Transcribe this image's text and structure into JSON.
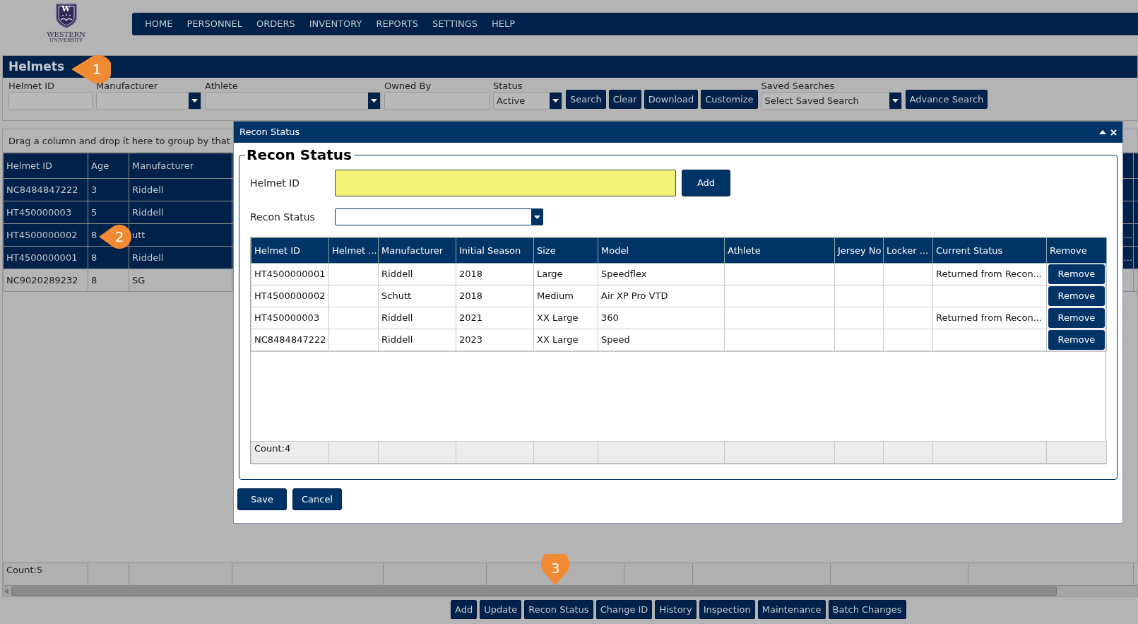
{
  "logo": {
    "monogram": "W",
    "name": "WESTERN",
    "subtitle": "UNIVERSITY"
  },
  "nav": [
    {
      "label": "HOME"
    },
    {
      "label": "PERSONNEL"
    },
    {
      "label": "ORDERS"
    },
    {
      "label": "INVENTORY"
    },
    {
      "label": "REPORTS"
    },
    {
      "label": "SETTINGS"
    },
    {
      "label": "HELP"
    }
  ],
  "panel": {
    "title": "Helmets"
  },
  "filters": [
    {
      "kind": "text",
      "label": "Helmet ID"
    },
    {
      "kind": "select",
      "label": "Manufacturer"
    },
    {
      "kind": "select",
      "label": "Athlete"
    },
    {
      "kind": "text",
      "label": "Owned By"
    },
    {
      "kind": "select",
      "label": "Status",
      "value": "Active"
    }
  ],
  "filter_buttons": [
    "Search",
    "Clear",
    "Download",
    "Customize"
  ],
  "saved_searches": {
    "label": "Saved Searches",
    "value": "Select Saved Search"
  },
  "advance_button": "Advance Search",
  "grid": {
    "group_hint": "Drag a column and drop it here to group by that",
    "columns": [
      "Helmet ID",
      "Age",
      "Manufacturer"
    ],
    "rows": [
      {
        "cells": [
          "NC8484847222",
          "3",
          "Riddell"
        ],
        "selected": true
      },
      {
        "cells": [
          "HT450000003",
          "5",
          "Riddell"
        ],
        "selected": true
      },
      {
        "cells": [
          "HT4500000002",
          "8",
          "utt"
        ],
        "selected": true,
        "tail": "..."
      },
      {
        "cells": [
          "HT4500000001",
          "8",
          "Riddell"
        ],
        "selected": true,
        "tail": "..."
      },
      {
        "cells": [
          "NC9020289232",
          "8",
          "SG"
        ],
        "selected": false
      }
    ],
    "count": "Count:5"
  },
  "actions": [
    "Add",
    "Update",
    "Recon Status",
    "Change ID",
    "History",
    "Inspection",
    "Maintenance",
    "Batch Changes"
  ],
  "dialog": {
    "title": "Recon Status",
    "legend": "Recon Status",
    "helmet_field": {
      "label": "Helmet ID"
    },
    "add_button": "Add",
    "status_field": {
      "label": "Recon Status"
    },
    "columns": [
      "Helmet ID",
      "Helmet ...",
      "Manufacturer",
      "Initial Season",
      "Size",
      "Model",
      "Athlete",
      "Jersey No",
      "Locker ...",
      "Current Status",
      "Remove"
    ],
    "rows": [
      {
        "cells": [
          "HT4500000001",
          "",
          "Riddell",
          "2018",
          "Large",
          "Speedflex",
          "",
          "",
          "",
          "Returned from Recon..."
        ],
        "button": "Remove"
      },
      {
        "cells": [
          "HT4500000002",
          "",
          "Schutt",
          "2018",
          "Medium",
          "Air XP Pro VTD",
          "",
          "",
          "",
          ""
        ],
        "button": "Remove"
      },
      {
        "cells": [
          "HT450000003",
          "",
          "Riddell",
          "2021",
          "XX Large",
          "360",
          "",
          "",
          "",
          "Returned from Recon..."
        ],
        "button": "Remove"
      },
      {
        "cells": [
          "NC8484847222",
          "",
          "Riddell",
          "2023",
          "XX Large",
          "Speed",
          "",
          "",
          "",
          ""
        ],
        "button": "Remove"
      }
    ],
    "count": "Count:4",
    "buttons": [
      "Save",
      "Cancel"
    ]
  },
  "callouts": [
    {
      "text": "1"
    },
    {
      "text": "2"
    },
    {
      "text": "3"
    }
  ]
}
